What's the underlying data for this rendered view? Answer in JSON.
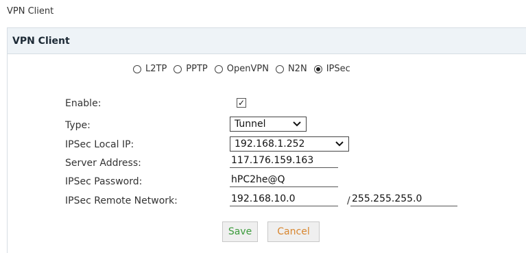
{
  "page": {
    "title": "VPN Client"
  },
  "panel": {
    "header": "VPN Client"
  },
  "protocols": {
    "options": [
      "L2TP",
      "PPTP",
      "OpenVPN",
      "N2N",
      "IPSec"
    ],
    "selected": "IPSec"
  },
  "form": {
    "enable": {
      "label": "Enable:",
      "checked": true
    },
    "type": {
      "label": "Type:",
      "value": "Tunnel"
    },
    "local_ip": {
      "label": "IPSec Local IP:",
      "value": "192.168.1.252"
    },
    "server_address": {
      "label": "Server Address:",
      "value": "117.176.159.163"
    },
    "password": {
      "label": "IPSec Password:",
      "value": "hPC2he@Q"
    },
    "remote_network": {
      "label": "IPSec Remote Network:",
      "network": "192.168.10.0",
      "separator": "/",
      "mask": "255.255.255.0"
    }
  },
  "buttons": {
    "save": "Save",
    "cancel": "Cancel"
  },
  "icons": {
    "dropdown": "chevron-down-icon",
    "check": "checkmark-icon"
  },
  "colors": {
    "save_text": "#3c9b3c",
    "cancel_text": "#d8862f",
    "header_bg": "#eef3f7"
  }
}
